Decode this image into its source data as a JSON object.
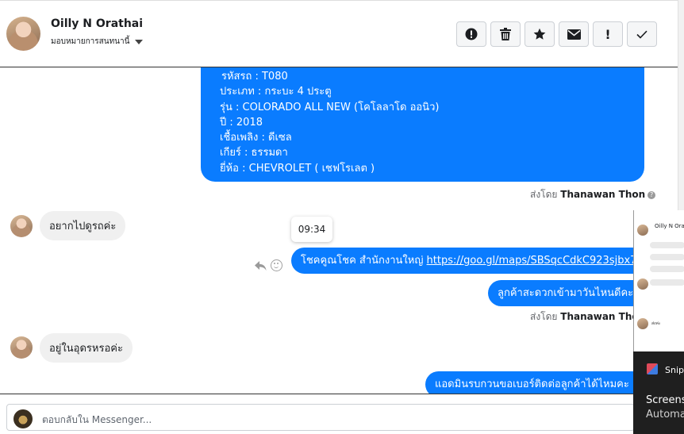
{
  "header": {
    "name": "Oilly N Orathai",
    "subtitle": "มอบหมายการสนทนานี้",
    "toolbar": {
      "spam_icon": "alert-circle-icon",
      "delete_icon": "trash-icon",
      "star_icon": "star-icon",
      "mail_icon": "envelope-icon",
      "important_label": "!",
      "done_icon": "checkmark-icon"
    }
  },
  "messages": {
    "car_details": [
      "รหัสรถ : T080",
      "ประเภท : กระบะ 4 ประตู",
      "รุ่น : COLORADO ALL NEW (โคโลลาโด ออนิว)",
      "ปี : 2018",
      "เชื้อเพลิง : ดีเซล",
      "เกียร์ : ธรรมดา",
      "ยี่ห้อ : CHEVROLET ( เชฟโรเลต )"
    ],
    "sent_by_prefix": "ส่งโดย",
    "sent_by_name": "Thanawan Thon",
    "in_1": "อยากไปดูรถค่ะ",
    "time_popover": "09:34",
    "out_2_prefix": "โชคคูณโชค สำนักงานใหญ่ ",
    "out_2_link": "https://goo.gl/maps/SBSqcCdkC923sjbx7",
    "out_3": "ลูกค้าสะดวกเข้ามาวันไหนดีคะ",
    "sent_by_prefix_2": "ส่งโดย",
    "sent_by_name_2": "Thanawan Thon",
    "in_2": "อยู่ในอุดรหรอค่ะ",
    "out_4": "แอดมินรบกวนขอเบอร์ติดต่อลูกค้าได้ไหมคะ"
  },
  "composer": {
    "placeholder": "ตอบกลับใน Messenger..."
  },
  "overlay": {
    "thumb_name": "Oilly N Orathai",
    "thumb_reply": "ส่งค่ะ",
    "notif_app": "Snip",
    "notif_line1": "Screens",
    "notif_line2": "Automa"
  },
  "colors": {
    "outgoing_bubble": "#0a7cff",
    "incoming_bubble": "#f0f0f0"
  }
}
